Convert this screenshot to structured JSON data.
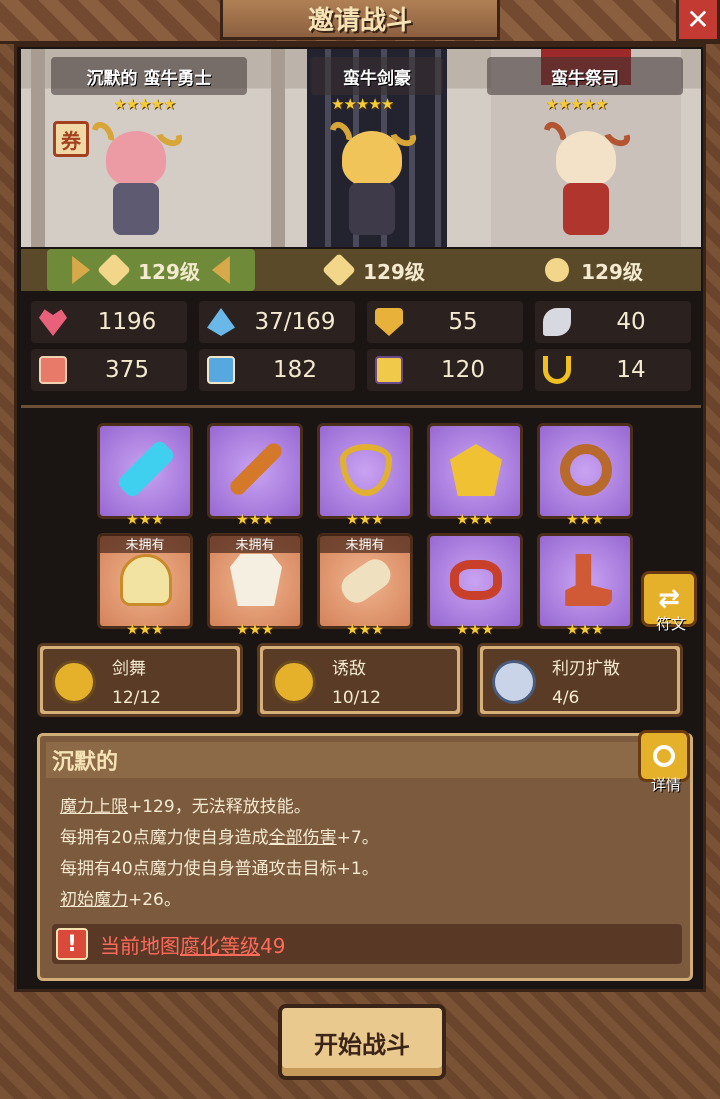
{
  "window": {
    "title": "邀请战斗",
    "close_label": "✕"
  },
  "heroes": [
    {
      "name": "沉默的 蛮牛勇士",
      "stars": "★★★★★",
      "level": "129级",
      "selected": true
    },
    {
      "name": "蛮牛剑豪",
      "stars": "★★★★★",
      "level": "129级",
      "selected": false
    },
    {
      "name": "蛮牛祭司",
      "stars": "★★★★★",
      "level": "129级",
      "selected": false
    }
  ],
  "stats": {
    "hp": "1196",
    "mana": "37/169",
    "armor": "55",
    "speed": "40",
    "attack": "375",
    "magic": "182",
    "range": "120",
    "dodge": "14"
  },
  "equipment": {
    "stars": "★★★",
    "unowned_label": "未拥有",
    "row1": [
      {
        "name": "ice-blade",
        "color": "#3fd0f0"
      },
      {
        "name": "dagger",
        "color": "#d4782a"
      },
      {
        "name": "necklace",
        "color": "#e2b030"
      },
      {
        "name": "wing-shield",
        "color": "#f0c233"
      },
      {
        "name": "ring",
        "color": "#b86a2c"
      }
    ],
    "row2": [
      {
        "name": "helmet",
        "color": "#f3e3a2"
      },
      {
        "name": "armor",
        "color": "#f4efe0"
      },
      {
        "name": "gauntlet",
        "color": "#efe1c0"
      },
      {
        "name": "belt",
        "color": "#c9402a"
      },
      {
        "name": "boots",
        "color": "#d05a36"
      }
    ]
  },
  "rune_label": "符文",
  "skills": [
    {
      "name": "剑舞",
      "count": "12/12"
    },
    {
      "name": "诱敌",
      "count": "10/12"
    },
    {
      "name": "利刃扩散",
      "count": "4/6"
    }
  ],
  "trait": {
    "title": "沉默的",
    "detail_label": "详情",
    "line1_a": "魔力上限",
    "line1_b": "+129，无法释放技能。",
    "line2_a": "每拥有20点魔力使自身造成",
    "line2_b": "全部伤害",
    "line2_c": "+7。",
    "line3": "每拥有40点魔力使自身普通攻击目标+1。",
    "line4_a": "初始魔力",
    "line4_b": "+26。",
    "warning_a": "当前地图",
    "warning_b": "腐化等级",
    "warning_c": "49"
  },
  "start_label": "开始战斗",
  "colors": {
    "accent_gold": "#e6b12a",
    "warning_red": "#ff6a5a",
    "stars_gold": "#f7cb35"
  }
}
